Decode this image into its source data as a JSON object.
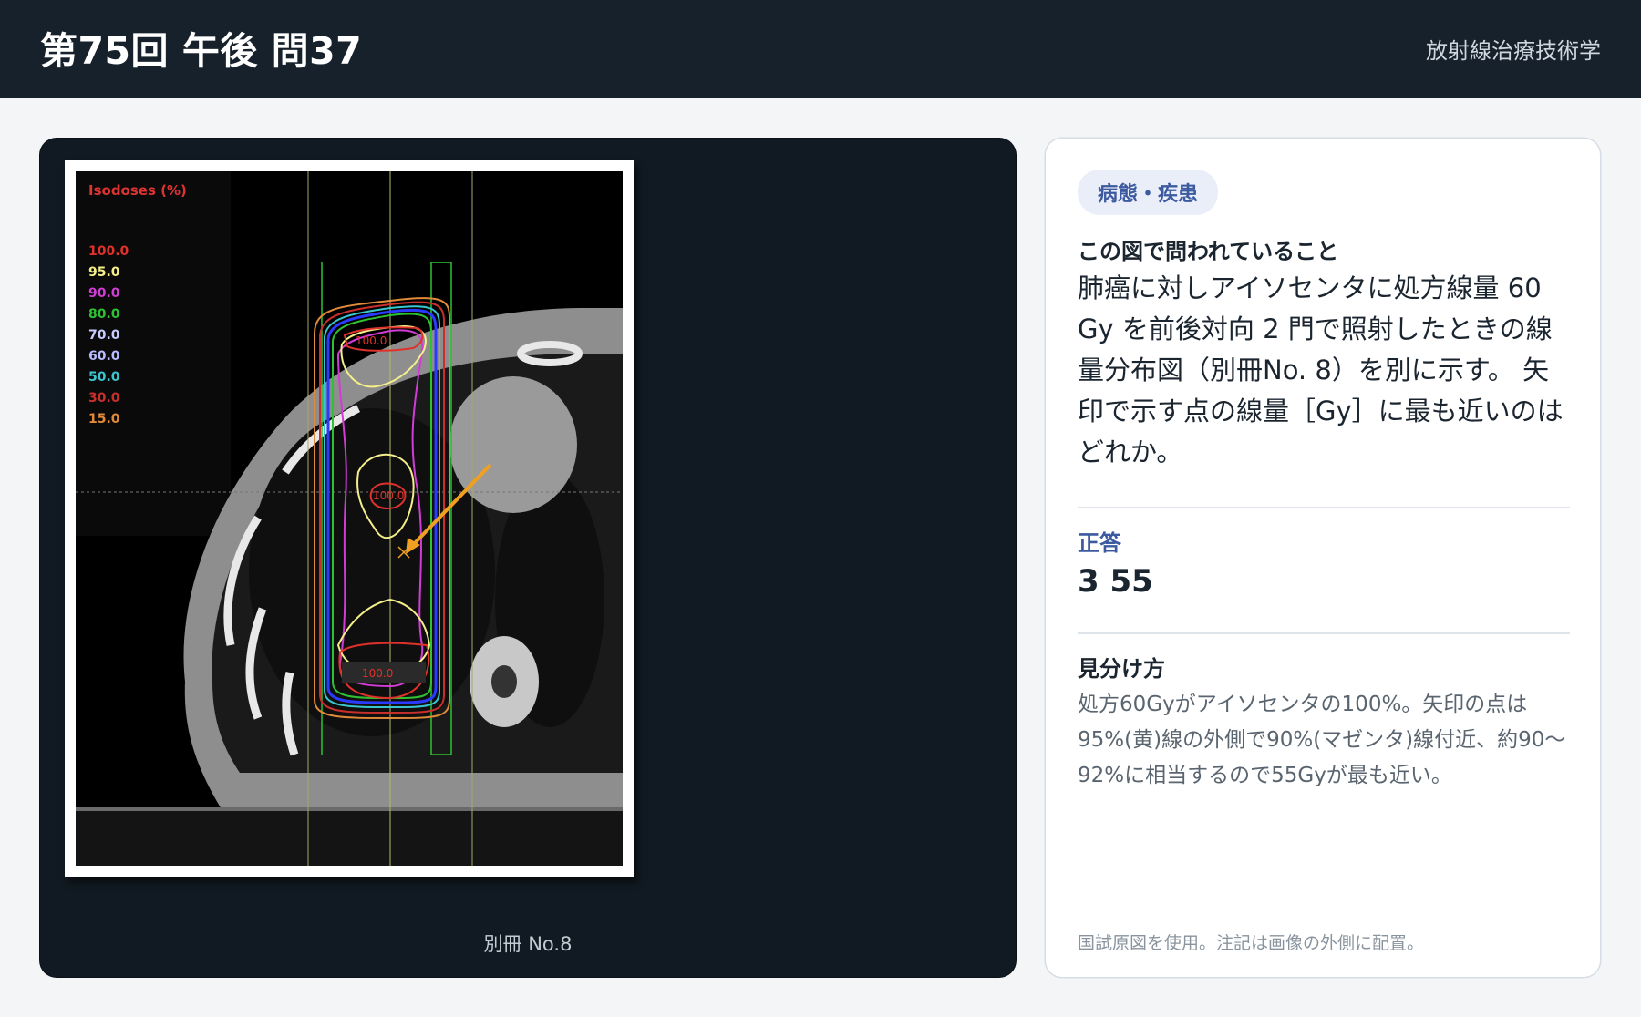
{
  "header": {
    "title": "第75回 午後 問37",
    "subject": "放射線治療技術学"
  },
  "figure": {
    "legend_title": "Isodoses (%)",
    "legend_items": [
      {
        "value": "100.0",
        "color": "#e0312b"
      },
      {
        "value": "95.0",
        "color": "#f4ef8a"
      },
      {
        "value": "90.0",
        "color": "#d23cd6"
      },
      {
        "value": "80.0",
        "color": "#2ec232"
      },
      {
        "value": "70.0",
        "color": "#c9ccff"
      },
      {
        "value": "60.0",
        "color": "#b8bcff"
      },
      {
        "value": "50.0",
        "color": "#39c6cf"
      },
      {
        "value": "30.0",
        "color": "#c9302c"
      },
      {
        "value": "15.0",
        "color": "#e08a3a"
      }
    ],
    "region_labels": [
      "100.0",
      "100.0",
      "100.0"
    ],
    "arrow_color": "#f0a020",
    "caption": "別冊 No.8"
  },
  "card": {
    "tag": "病態・疾患",
    "question_label": "この図で問われていること",
    "question_text": "肺癌に対しアイソセンタに処方線量 60 Gy を前後対向 2 門で照射したときの線量分布図（別冊No. 8）を別に示す。 矢印で示す点の線量［Gy］に最も近いのはどれか。",
    "answer_label": "正答",
    "answer_value": "3 55",
    "tips_label": "見分け方",
    "tips_text": "処方60Gyがアイソセンタの100%。矢印の点は95%(黄)線の外側で90%(マゼンタ)線付近、約90〜92%に相当するので55Gyが最も近い。",
    "note": "国試原図を使用。注記は画像の外側に配置。"
  }
}
